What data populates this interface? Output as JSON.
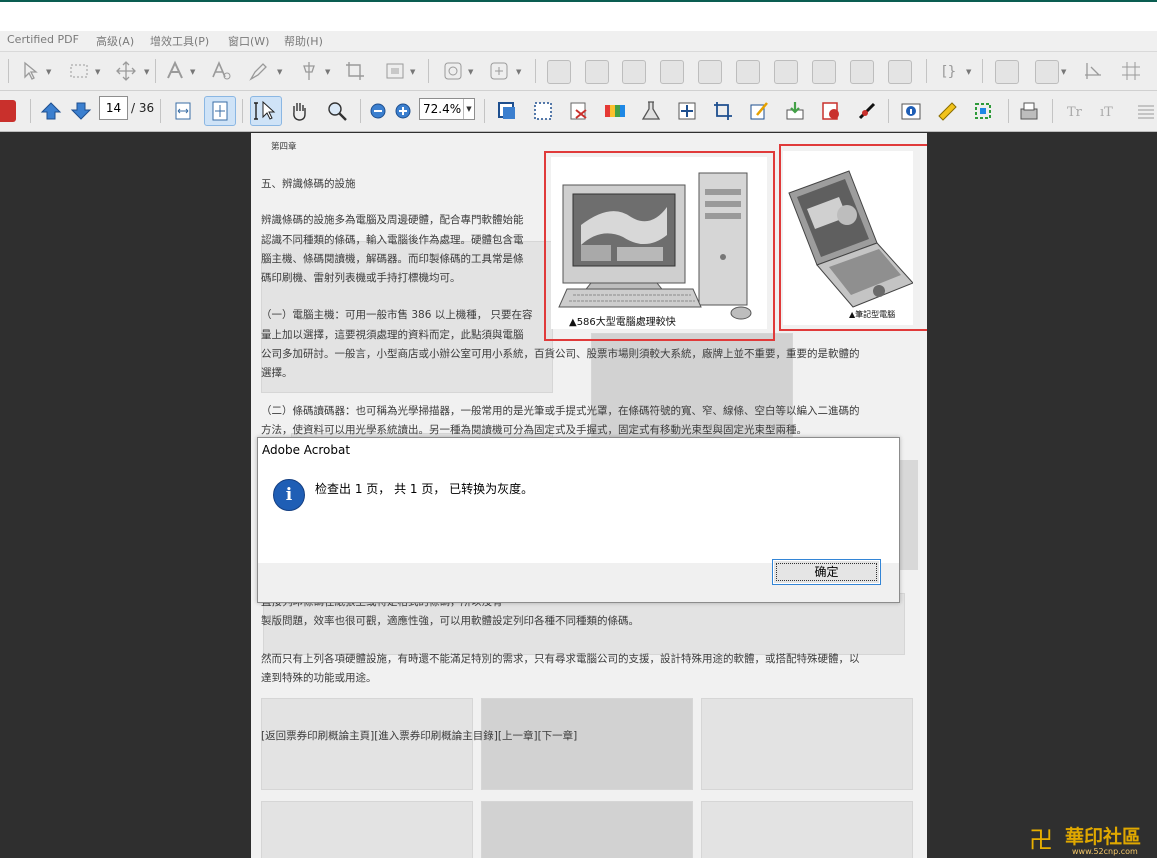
{
  "menu": [
    "Certified PDF",
    "高级(A)",
    "增效工具(P)",
    "窗口(W)",
    "帮助(H)"
  ],
  "navigation": {
    "current_page": "14",
    "total_pages": "/ 36",
    "zoom": "72.4%"
  },
  "document": {
    "chapter": "第四章",
    "section_title": "五、辨識條碼的設施",
    "para1": [
      "辨識條碼的設施多為電腦及周邊硬體，配合專門軟體始能",
      "認識不同種類的條碼，輸入電腦後作為處理。硬體包含電",
      "腦主機、條碼閱讀機，解碼器。而印製條碼的工具常是條",
      "碼印刷機、雷射列表機或手持打標機均可。"
    ],
    "para2": [
      "（一）電腦主機：可用一般市售 386 以上機種， 只要在容",
      "量上加以選擇，這要視須處理的資料而定，此點須與電腦",
      "公司多加研討。一般言，小型商店或小辦公室可用小系統，百貨公司、股票市場則須較大系統，廠牌上並不重要，重要的是軟體的",
      "選擇。"
    ],
    "para3": [
      "（二）條碼讀碼器：也可稱為光學掃描器，一般常用的是光筆或手提式光罩，在條碼符號的寬、窄、線條、空白等以編入二進碼的",
      "方法，使資料可以用光學系統讀出。另一種為閱讀機可分為固定式及手握式，固定式有移動光束型與固定光束型兩種。"
    ],
    "para4": [
      "直接列印條碼在紙張上或特定格式的條碼，所以沒有",
      "製版問題，效率也很可觀，適應性強，可以用軟體設定列印各種不同種類的條碼。"
    ],
    "para5": [
      "然而只有上列各項硬體設施，有時還不能滿足特別的需求，只有尋求電腦公司的支援，設計特殊用途的軟體，或搭配特殊硬體，以",
      "達到特殊的功能或用途。"
    ],
    "links": "[返回票券印刷概論主頁][進入票券印刷概論主目錄][上一章][下一章]",
    "image1_caption": "▲586大型電腦處理較快",
    "image2_caption": "▲筆記型電腦"
  },
  "dialog": {
    "title": "Adobe Acrobat",
    "message": "检查出 1 页， 共 1 页， 已转换为灰度。",
    "ok_label": "确定",
    "icon": "info-icon"
  },
  "watermark": {
    "logo": "卍",
    "name": "華印社區",
    "url": "www.52cnp.com"
  },
  "colors": {
    "dialog_button_border": "#3385d6",
    "info_icon": "#1f5eb5",
    "annotation_frame": "#e03a3a"
  }
}
